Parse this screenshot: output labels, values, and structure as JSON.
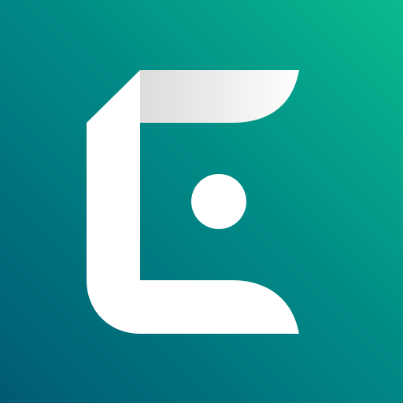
{
  "icon": {
    "name": "app-logo-icon",
    "colors": {
      "background_dark": "#005a73",
      "background_mid": "#008a86",
      "background_light": "#0aba8e",
      "glyph": "#ffffff",
      "top_bar_shade": "#dcdcda"
    }
  }
}
